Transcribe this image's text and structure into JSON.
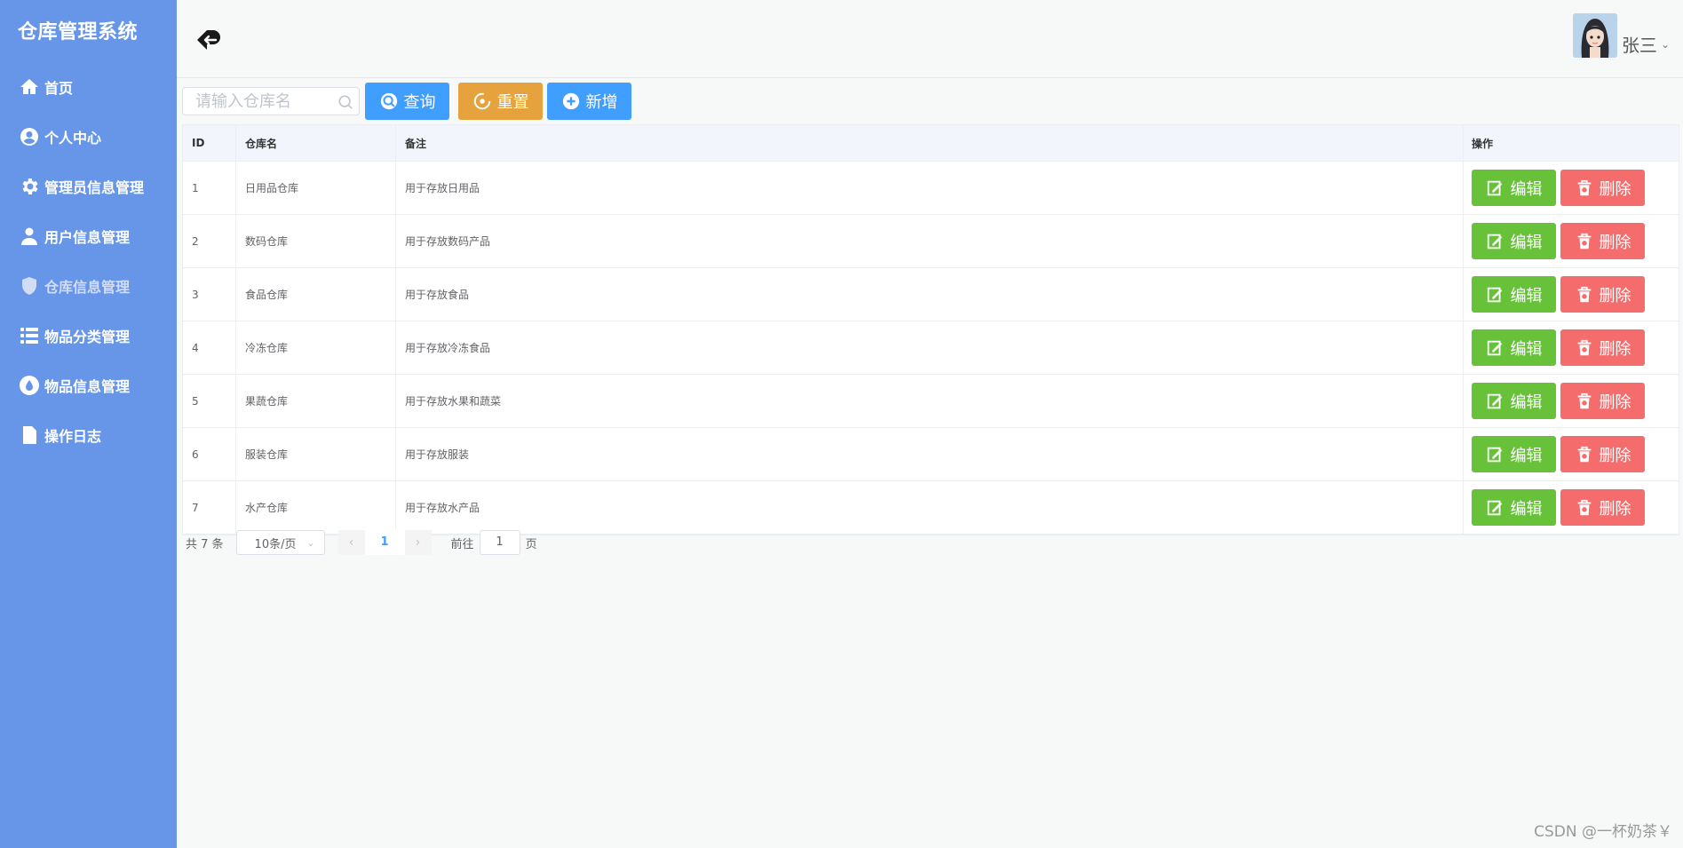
{
  "app": {
    "title": "仓库管理系统"
  },
  "sidebar": {
    "items": [
      {
        "label": "首页",
        "icon": "home-icon"
      },
      {
        "label": "个人中心",
        "icon": "user-circle-icon"
      },
      {
        "label": "管理员信息管理",
        "icon": "gear-icon"
      },
      {
        "label": "用户信息管理",
        "icon": "user-icon"
      },
      {
        "label": "仓库信息管理",
        "icon": "shield-icon",
        "active": true
      },
      {
        "label": "物品分类管理",
        "icon": "list-icon"
      },
      {
        "label": "物品信息管理",
        "icon": "drop-icon"
      },
      {
        "label": "操作日志",
        "icon": "document-icon"
      }
    ]
  },
  "header": {
    "username": "张三"
  },
  "toolbar": {
    "search_placeholder": "请输入仓库名",
    "query_label": "查询",
    "reset_label": "重置",
    "add_label": "新增"
  },
  "table": {
    "columns": [
      "ID",
      "仓库名",
      "备注",
      "操作"
    ],
    "rows": [
      {
        "id": "1",
        "name": "日用品仓库",
        "note": "用于存放日用品"
      },
      {
        "id": "2",
        "name": "数码仓库",
        "note": "用于存放数码产品"
      },
      {
        "id": "3",
        "name": "食品仓库",
        "note": "用于存放食品"
      },
      {
        "id": "4",
        "name": "冷冻仓库",
        "note": "用于存放冷冻食品"
      },
      {
        "id": "5",
        "name": "果蔬仓库",
        "note": "用于存放水果和蔬菜"
      },
      {
        "id": "6",
        "name": "服装仓库",
        "note": "用于存放服装"
      },
      {
        "id": "7",
        "name": "水产仓库",
        "note": "用于存放水产品"
      }
    ],
    "edit_label": "编辑",
    "delete_label": "删除"
  },
  "pagination": {
    "total_text": "共 7 条",
    "page_size": "10条/页",
    "current_page": "1",
    "goto_label": "前往",
    "goto_value": "1",
    "page_suffix": "页"
  },
  "watermark": "CSDN @一杯奶茶￥",
  "colors": {
    "sidebar": "#6796e9",
    "primary": "#409eff",
    "warning": "#e6a23c",
    "success": "#67c23a",
    "danger": "#f56c6c"
  }
}
